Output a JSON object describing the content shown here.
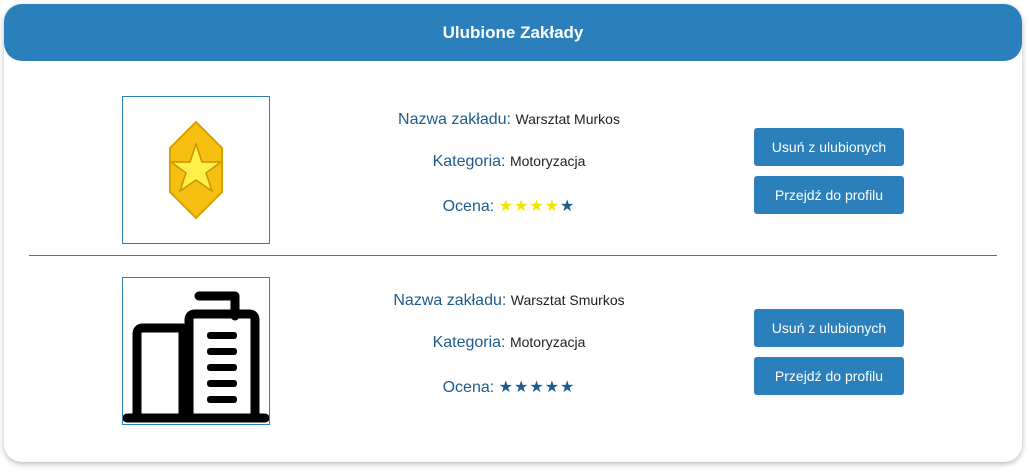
{
  "header": {
    "title": "Ulubione Zakłady"
  },
  "labels": {
    "name": "Nazwa zakładu:",
    "category": "Kategoria:",
    "rating": "Ocena:",
    "remove_button": "Usuń z ulubionych",
    "profile_button": "Przejdź do profilu"
  },
  "items": [
    {
      "name": "Warsztat Murkos",
      "category": "Motoryzacja",
      "rating": 4,
      "rating_max": 5,
      "icon": "gold-star-badge-icon"
    },
    {
      "name": "Warsztat Smurkos",
      "category": "Motoryzacja",
      "rating": 0,
      "rating_max": 5,
      "icon": "building-icon"
    }
  ],
  "colors": {
    "accent": "#2b80bb",
    "star_filled": "#f2e500",
    "star_empty": "#1f5b8c"
  }
}
